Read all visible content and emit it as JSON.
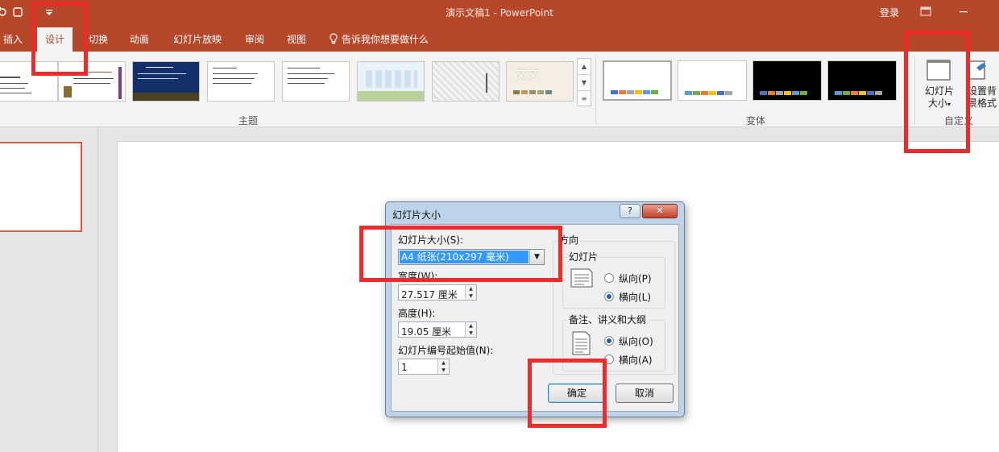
{
  "titlebar": {
    "doc_title": "演示文稿1 - PowerPoint",
    "login": "登录",
    "quick_access_icons": [
      "undo-icon",
      "start-icon",
      "customize-qat-icon"
    ],
    "window_buttons": [
      "ribbon-display-icon",
      "minimize-icon"
    ]
  },
  "tabs": [
    {
      "label": "插入",
      "active": false
    },
    {
      "label": "设计",
      "active": true
    },
    {
      "label": "切换",
      "active": false
    },
    {
      "label": "动画",
      "active": false
    },
    {
      "label": "幻灯片放映",
      "active": false
    },
    {
      "label": "审阅",
      "active": false
    },
    {
      "label": "视图",
      "active": false
    }
  ],
  "tell_me": "告诉我你想要做什么",
  "ribbon": {
    "themes_label": "主题",
    "variants_label": "变体",
    "customize_label": "自定义",
    "slide_size_label": "幻灯片大小",
    "slide_size_caret": "▾",
    "format_bg_label": "设置背景格式",
    "theme_preview_text": "文文"
  },
  "dialog": {
    "title": "幻灯片大小",
    "help": "?",
    "close": "✕",
    "slide_size_label": "幻灯片大小(S):",
    "slide_size_value": "A4 纸张(210x297 毫米)",
    "width_label": "宽度(W):",
    "width_value": "27.517 厘米",
    "height_label": "高度(H):",
    "height_value": "19.05 厘米",
    "number_from_label": "幻灯片编号起始值(N):",
    "number_from_value": "1",
    "orientation_label": "方向",
    "slides_label": "幻灯片",
    "slides_portrait": "纵向(P)",
    "slides_landscape": "横向(L)",
    "slides_selected": "landscape",
    "notes_label": "备注、讲义和大纲",
    "notes_portrait": "纵向(O)",
    "notes_landscape": "横向(A)",
    "notes_selected": "portrait",
    "ok": "确定",
    "cancel": "取消"
  },
  "colors": {
    "accent": "#b7472a",
    "highlight": "#ee2b2b"
  }
}
